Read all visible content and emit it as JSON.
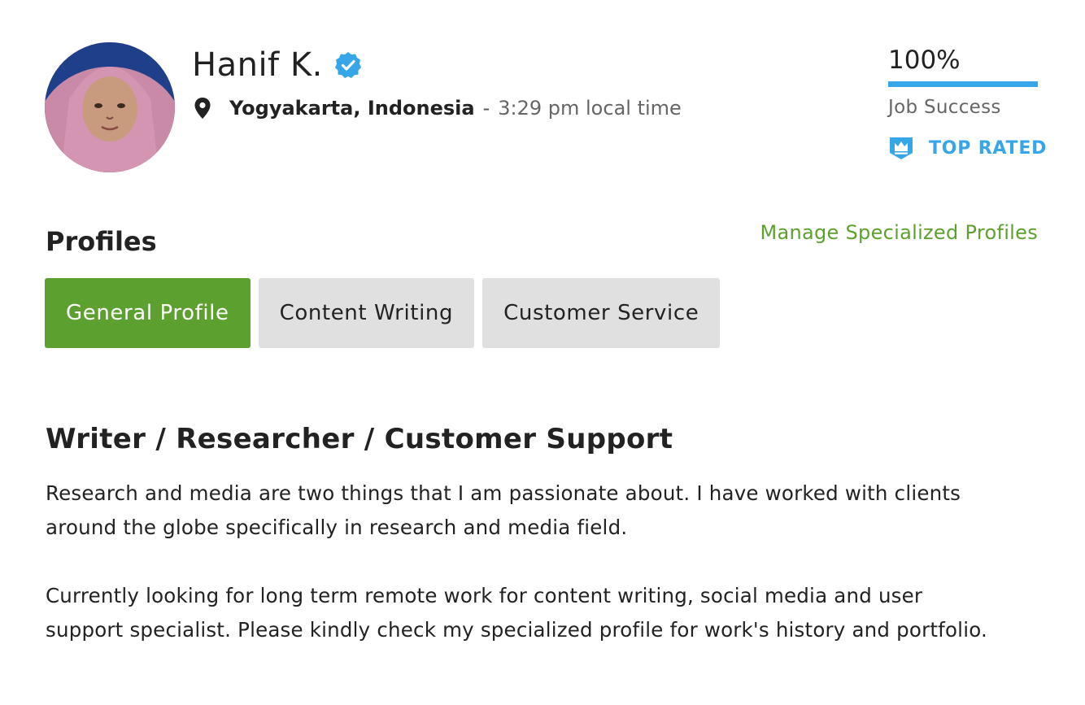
{
  "profile": {
    "name": "Hanif K.",
    "location": "Yogyakarta, Indonesia",
    "separator": "-",
    "local_time": "3:29 pm local time"
  },
  "stats": {
    "job_success_value": "100%",
    "job_success_fraction": 1.0,
    "job_success_label": "Job Success",
    "badge_label": "TOP RATED"
  },
  "section": {
    "title": "Profiles",
    "manage_link": "Manage Specialized Profiles"
  },
  "tabs": [
    {
      "label": "General Profile",
      "active": true
    },
    {
      "label": "Content Writing",
      "active": false
    },
    {
      "label": "Customer Service",
      "active": false
    }
  ],
  "content": {
    "headline": "Writer / Researcher / Customer Support",
    "paragraphs": [
      "Research and media are two things that I am passionate about. I have worked with clients around the globe specifically in research and media field.",
      "Currently looking for long term remote work for content writing, social media and user support specialist. Please kindly check my specialized profile for work's history and portfolio."
    ]
  },
  "colors": {
    "accent_green": "#5ca12f",
    "accent_blue": "#37a6e8",
    "tab_inactive_bg": "#e0e0e0"
  },
  "icons": {
    "verified": "verified-badge-icon",
    "location": "map-pin-icon",
    "top_rated": "crown-shield-icon"
  }
}
